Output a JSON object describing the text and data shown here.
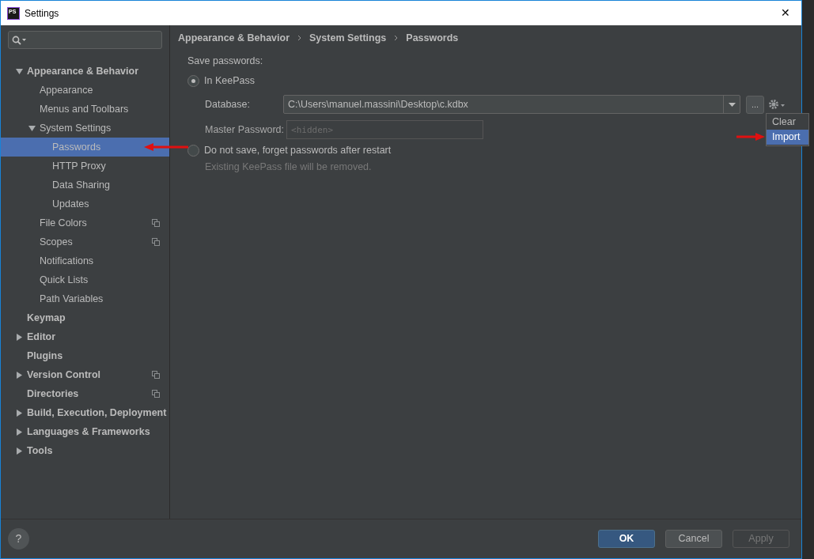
{
  "window": {
    "title": "Settings",
    "app_icon": "PS",
    "close": "✕"
  },
  "sidebar": {
    "items": [
      {
        "label": "Appearance & Behavior",
        "bold": true,
        "expanded": true,
        "selected": false,
        "project_level": false,
        "children": [
          {
            "label": "Appearance",
            "selected": false,
            "project_level": false
          },
          {
            "label": "Menus and Toolbars",
            "selected": false,
            "project_level": false
          },
          {
            "label": "System Settings",
            "expanded": true,
            "selected": false,
            "project_level": false,
            "children": [
              {
                "label": "Passwords",
                "selected": true,
                "project_level": false
              },
              {
                "label": "HTTP Proxy",
                "selected": false,
                "project_level": false
              },
              {
                "label": "Data Sharing",
                "selected": false,
                "project_level": false
              },
              {
                "label": "Updates",
                "selected": false,
                "project_level": false
              }
            ]
          },
          {
            "label": "File Colors",
            "selected": false,
            "project_level": true
          },
          {
            "label": "Scopes",
            "selected": false,
            "project_level": true
          },
          {
            "label": "Notifications",
            "selected": false,
            "project_level": false
          },
          {
            "label": "Quick Lists",
            "selected": false,
            "project_level": false
          },
          {
            "label": "Path Variables",
            "selected": false,
            "project_level": false
          }
        ]
      },
      {
        "label": "Keymap",
        "bold": true,
        "selected": false,
        "project_level": false
      },
      {
        "label": "Editor",
        "bold": true,
        "expanded": false,
        "selected": false,
        "project_level": false
      },
      {
        "label": "Plugins",
        "bold": true,
        "selected": false,
        "project_level": false
      },
      {
        "label": "Version Control",
        "bold": true,
        "expanded": false,
        "selected": false,
        "project_level": true
      },
      {
        "label": "Directories",
        "bold": true,
        "selected": false,
        "project_level": true
      },
      {
        "label": "Build, Execution, Deployment",
        "bold": true,
        "expanded": false,
        "selected": false,
        "project_level": false
      },
      {
        "label": "Languages & Frameworks",
        "bold": true,
        "expanded": false,
        "selected": false,
        "project_level": false
      },
      {
        "label": "Tools",
        "bold": true,
        "expanded": false,
        "selected": false,
        "project_level": false
      }
    ]
  },
  "breadcrumbs": [
    "Appearance & Behavior",
    "System Settings",
    "Passwords"
  ],
  "content": {
    "heading": "Save passwords:",
    "options": [
      {
        "label": "In KeePass",
        "selected": true
      },
      {
        "label": "Do not save, forget passwords after restart",
        "selected": false,
        "note": "Existing KeePass file will be removed."
      }
    ],
    "database": {
      "label": "Database:",
      "value": "C:\\Users\\manuel.massini\\Desktop\\c.kdbx",
      "browse": "..."
    },
    "master_password": {
      "label": "Master Password:",
      "placeholder": "<hidden>",
      "disabled": true
    },
    "gear_menu": [
      {
        "label": "Clear",
        "selected": false
      },
      {
        "label": "Import",
        "selected": true
      }
    ]
  },
  "footer": {
    "help": "?",
    "buttons": [
      {
        "label": "OK",
        "default": true,
        "disabled": false
      },
      {
        "label": "Cancel",
        "default": false,
        "disabled": false
      },
      {
        "label": "Apply",
        "default": false,
        "disabled": true
      }
    ]
  }
}
